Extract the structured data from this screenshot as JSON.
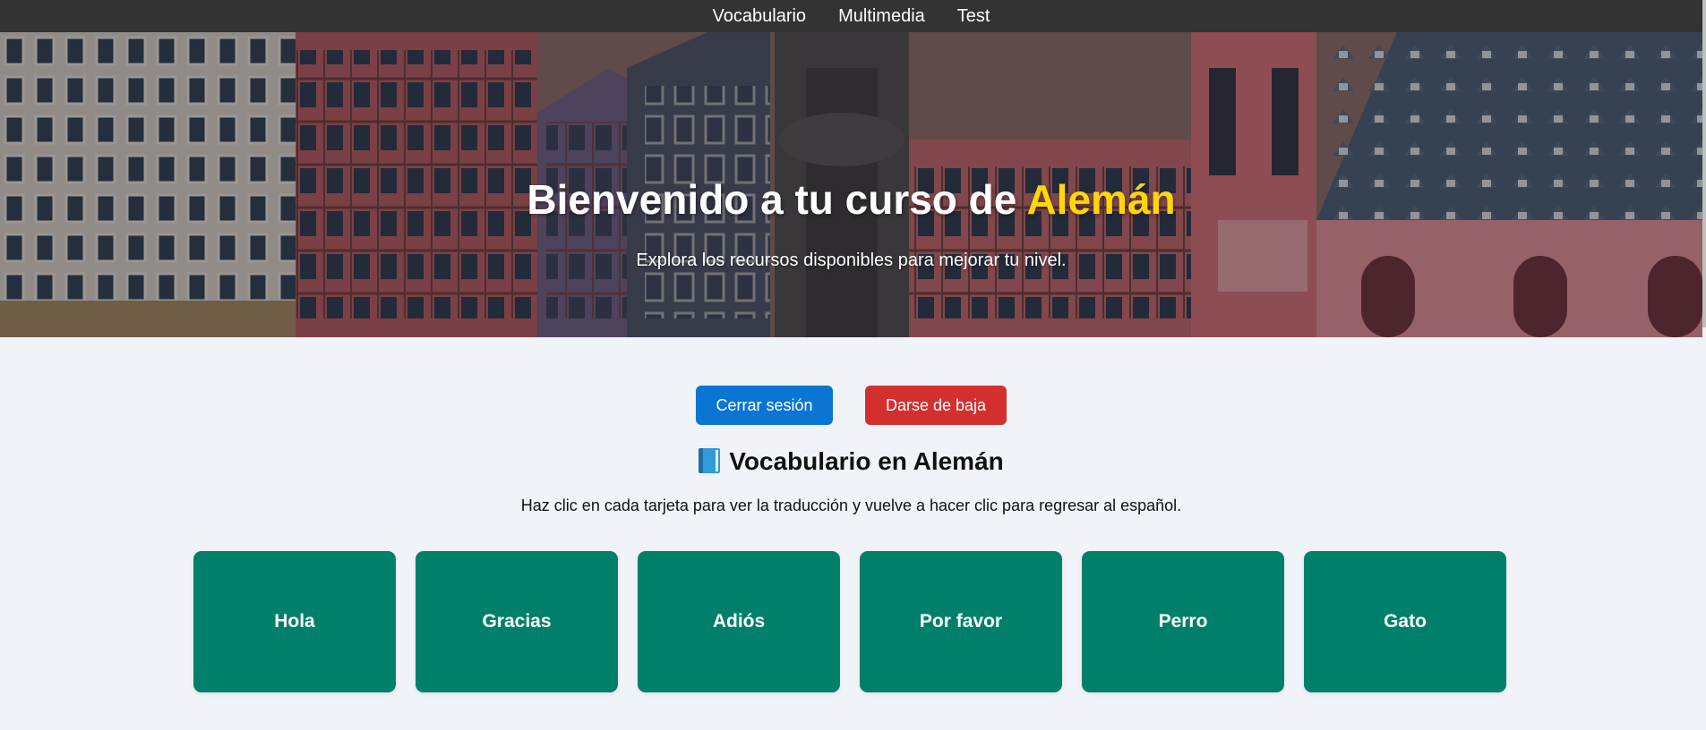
{
  "nav": {
    "items": [
      {
        "label": "Vocabulario"
      },
      {
        "label": "Multimedia"
      },
      {
        "label": "Test"
      }
    ]
  },
  "hero": {
    "title_prefix": "Bienvenido a tu curso de ",
    "title_language": "Alemán",
    "subtitle": "Explora los recursos disponibles para mejorar tu nivel.",
    "highlight_color": "#ffd60a"
  },
  "actions": {
    "logout_label": "Cerrar sesión",
    "unsubscribe_label": "Darse de baja"
  },
  "vocab": {
    "icon": "blue-book-icon",
    "title": "Vocabulario en Alemán",
    "instructions": "Haz clic en cada tarjeta para ver la traducción y vuelve a hacer clic para regresar al español.",
    "cards": [
      {
        "label": "Hola"
      },
      {
        "label": "Gracias"
      },
      {
        "label": "Adiós"
      },
      {
        "label": "Por favor"
      },
      {
        "label": "Perro"
      },
      {
        "label": "Gato"
      }
    ]
  },
  "colors": {
    "nav_bg": "#333333",
    "page_bg": "#f0f3f8",
    "primary": "#0a75d2",
    "danger": "#d32f2f",
    "card_bg": "#00806a"
  }
}
